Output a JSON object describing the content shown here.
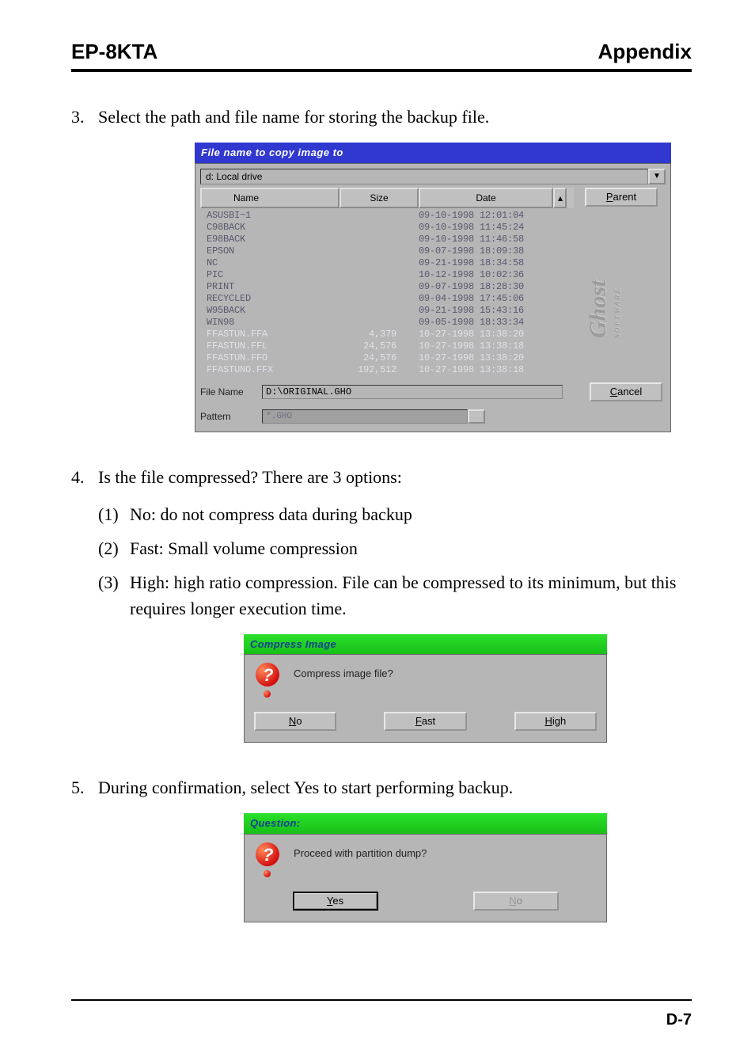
{
  "header": {
    "left": "EP-8KTA",
    "right": "Appendix"
  },
  "step3": {
    "num": "3.",
    "text": "Select the path and file name for storing the backup file."
  },
  "dlg1": {
    "title": "File name to copy image to",
    "drive": "d: Local drive",
    "cols": {
      "name": "Name",
      "size": "Size",
      "date": "Date"
    },
    "rows": [
      {
        "name": "ASUSBI~1",
        "size": "",
        "date": "09-10-1998 12:01:04",
        "sel": false
      },
      {
        "name": "C98BACK",
        "size": "",
        "date": "09-10-1998 11:45:24",
        "sel": false
      },
      {
        "name": "E98BACK",
        "size": "",
        "date": "09-10-1998 11:46:58",
        "sel": false
      },
      {
        "name": "EPSON",
        "size": "",
        "date": "09-07-1998 18:09:38",
        "sel": false
      },
      {
        "name": "NC",
        "size": "",
        "date": "09-21-1998 18:34:58",
        "sel": false
      },
      {
        "name": "PIC",
        "size": "",
        "date": "10-12-1998 10:02:36",
        "sel": false
      },
      {
        "name": "PRINT",
        "size": "",
        "date": "09-07-1998 18:28:30",
        "sel": false
      },
      {
        "name": "RECYCLED",
        "size": "",
        "date": "09-04-1998 17:45:06",
        "sel": false
      },
      {
        "name": "W95BACK",
        "size": "",
        "date": "09-21-1998 15:43:16",
        "sel": false
      },
      {
        "name": "WIN98",
        "size": "",
        "date": "09-05-1998 18:33:34",
        "sel": false
      },
      {
        "name": "FFASTUN.FFA",
        "size": "4,379",
        "date": "10-27-1998 13:38:20",
        "sel": true
      },
      {
        "name": "FFASTUN.FFL",
        "size": "24,576",
        "date": "10-27-1998 13:38:18",
        "sel": true
      },
      {
        "name": "FFASTUN.FFO",
        "size": "24,576",
        "date": "10-27-1998 13:38:20",
        "sel": true
      },
      {
        "name": "FFASTUNO.FFX",
        "size": "192,512",
        "date": "10-27-1998 13:38:18",
        "sel": true
      }
    ],
    "parent_btn": "Parent",
    "watermark": "Ghost",
    "watermark_sub": "SOFTWARE",
    "filename_label": "File Name",
    "filename_value": "D:\\ORIGINAL.GHO",
    "cancel_btn": "Cancel",
    "pattern_label": "Pattern",
    "pattern_value": "*.GHO"
  },
  "step4": {
    "num": "4.",
    "text": "Is the file compressed? There are 3 options:",
    "opts": [
      {
        "n": "(1)",
        "t": "No: do not compress data during backup"
      },
      {
        "n": "(2)",
        "t": "Fast: Small volume compression"
      },
      {
        "n": "(3)",
        "t": "High: high ratio compression.  File can be compressed to its minimum, but this requires longer execution time."
      }
    ]
  },
  "dlg2": {
    "title": "Compress Image",
    "msg": "Compress image file?",
    "btns": {
      "no": "No",
      "fast": "Fast",
      "high": "High"
    }
  },
  "step5": {
    "num": "5.",
    "text": "During confirmation, select Yes to start performing backup."
  },
  "dlg3": {
    "title": "Question:",
    "msg": "Proceed with partition dump?",
    "btns": {
      "yes": "Yes",
      "no": "No"
    }
  },
  "page_num": "D-7"
}
